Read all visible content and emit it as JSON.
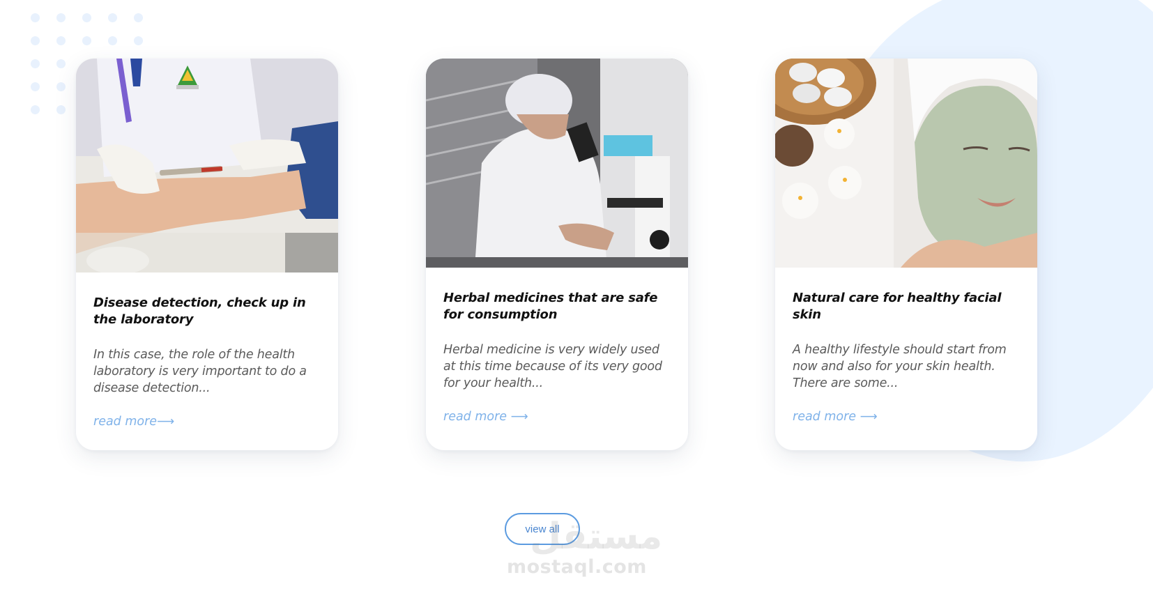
{
  "colors": {
    "accent": "#7fb2e9",
    "button_border": "#5b9be0",
    "background_blob": "#e9f3ff",
    "title": "#111111",
    "body_text": "#5a5a5a"
  },
  "cards": [
    {
      "image_icon": "lab-blood-test-photo",
      "title": "Disease detection, check up in the laboratory",
      "text": "In this case, the role of the health laboratory is very important to do a disease detection...",
      "link": "read more⟶"
    },
    {
      "image_icon": "scientist-microscope-photo",
      "title": "Herbal medicines that are safe for consumption",
      "text": "Herbal medicine is very widely used at this time because of its very good for your health...",
      "link": "read more ⟶"
    },
    {
      "image_icon": "facial-mask-spa-photo",
      "title": "Natural care for healthy facial skin",
      "text": "A healthy lifestyle should start from now and also for your skin health.\nThere are some...",
      "link": "read more ⟶"
    }
  ],
  "view_all_label": "view all",
  "watermark": {
    "arabic": "مستقل",
    "text": "mostaql.com"
  }
}
